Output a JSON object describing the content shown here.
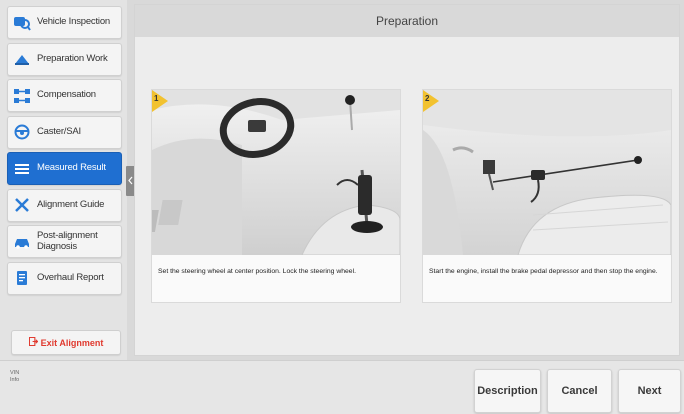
{
  "sidebar": {
    "items": [
      {
        "label": "Vehicle Inspection",
        "icon": "vehicle-inspection-icon",
        "active": false
      },
      {
        "label": "Preparation Work",
        "icon": "preparation-icon",
        "active": false
      },
      {
        "label": "Compensation",
        "icon": "compensation-icon",
        "active": false
      },
      {
        "label": "Caster/SAI",
        "icon": "steering-wheel-icon",
        "active": false
      },
      {
        "label": "Measured Result",
        "icon": "result-list-icon",
        "active": true
      },
      {
        "label": "Alignment Guide",
        "icon": "alignment-tools-icon",
        "active": false
      },
      {
        "label": "Post-alignment Diagnosis",
        "icon": "car-diagnosis-icon",
        "active": false
      },
      {
        "label": "Overhaul Report",
        "icon": "report-icon",
        "active": false
      }
    ],
    "exit_label": "Exit Alignment"
  },
  "main": {
    "title": "Preparation",
    "cards": [
      {
        "step": "1",
        "caption": "Set the steering wheel at center position. Lock the steering wheel."
      },
      {
        "step": "2",
        "caption": "Start the engine, install the brake pedal depressor and then stop the engine."
      }
    ]
  },
  "footer": {
    "vin_label": "VIN",
    "info_label": "Info",
    "buttons": {
      "description": "Description",
      "cancel": "Cancel",
      "next": "Next"
    }
  },
  "colors": {
    "accent": "#1f6fd1",
    "exit": "#e03a2f",
    "badge": "#f2c230"
  }
}
